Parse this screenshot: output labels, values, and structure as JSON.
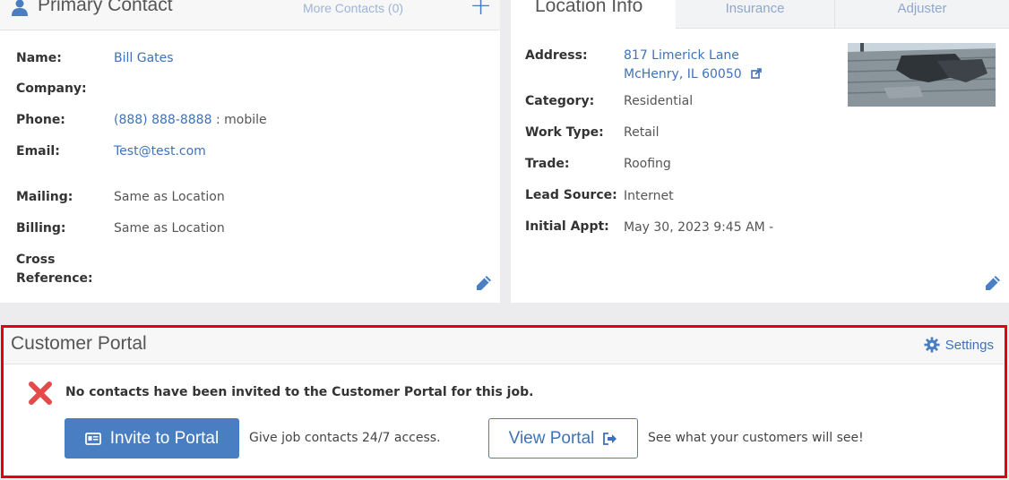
{
  "contact": {
    "title": "Primary Contact",
    "more_contacts": "More Contacts (0)",
    "fields": {
      "name_label": "Name:",
      "name_value": "Bill Gates",
      "company_label": "Company:",
      "phone_label": "Phone:",
      "phone_value": "(888) 888-8888",
      "phone_type": " : mobile",
      "email_label": "Email:",
      "email_value": "Test@test.com",
      "mailing_label": "Mailing:",
      "mailing_value": "Same as Location",
      "billing_label": "Billing:",
      "billing_value": "Same as Location",
      "cross_label_1": "Cross",
      "cross_label_2": "Reference:"
    }
  },
  "location": {
    "tabs": [
      "Location Info",
      "Insurance",
      "Adjuster"
    ],
    "fields": {
      "address_label": "Address:",
      "address_line1": "817 Limerick Lane",
      "address_line2": "McHenry, IL 60050",
      "category_label": "Category:",
      "category_value": "Residential",
      "worktype_label": "Work Type:",
      "worktype_value": "Retail",
      "trade_label": "Trade:",
      "trade_value": "Roofing",
      "leadsource_label": "Lead Source:",
      "leadsource_value": "Internet",
      "appt_label": "Initial Appt:",
      "appt_value": "May 30, 2023 9:45 AM -"
    }
  },
  "portal": {
    "title": "Customer Portal",
    "settings_label": "Settings",
    "message": "No contacts have been invited to the Customer Portal for this job.",
    "invite_label": "Invite to Portal",
    "invite_hint": "Give job contacts 24/7 access.",
    "view_label": "View Portal",
    "view_hint": "See what your customers will see!"
  },
  "colors": {
    "accent": "#4a7ec2",
    "link": "#3f72b8",
    "highlight_border": "#e3000f",
    "error_x": "#e34a4a"
  },
  "icons": [
    "user-icon",
    "plus-icon",
    "pencil-icon",
    "external-link-icon",
    "gear-icon",
    "x-icon",
    "id-card-icon",
    "sign-out-icon"
  ]
}
